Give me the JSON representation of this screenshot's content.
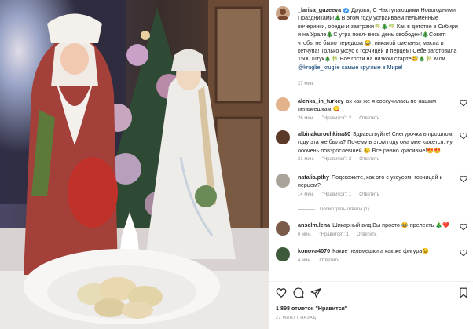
{
  "post": {
    "username": "_larisa_guzeeva",
    "caption": "Друзья, С Наступающими Новогодними Праздниками!🎄В этом году устраиваем пельменные вечеринки, обеды и завтраки🎋🎄🎋 Как в детстве в Сибири и на Урале🎄С утра поел- весь день свободен!🎄Совет: чтобы не было передоза 😂, никакой сметаны, масла и кетчупа! Только уксус с горчицей и перцем! Себе заготовила 1500 штук🎄🎋 Все гости на низком старте😅🎄🎋 Мои",
    "hashtag": "@kruglie_kruglie самые круглые в Мире!",
    "time": "27 мин."
  },
  "comments": [
    {
      "username": "alenka_in_turkey",
      "text": "ах как же я соскучилась по нашим пельмешкам 😋",
      "time": "26 мин.",
      "likes": "\"Нравится\": 2",
      "reply": "Ответить"
    },
    {
      "username": "albinakurochkina80",
      "text": "Здравствуйте! Снегурочка в прошлом году эта же была? Почему в этом году она мне кажется, ну ооочень повзрослевшей 😉 Все равно красивые!😍😍",
      "time": "21 мин.",
      "likes": "\"Нравится\": 2",
      "reply": "Ответить"
    },
    {
      "username": "natalia.pthy",
      "text": "Подскажите, как это с уксусом, горчицей и перцем?",
      "time": "14 мин.",
      "likes": "\"Нравится\": 1",
      "reply": "Ответить",
      "view_replies": "Посмотреть ответы (1)"
    },
    {
      "username": "anselm.lena",
      "text": "Шикарный вид.Вы просто 😂 прелесть 🎄❤️",
      "time": "6 мин.",
      "likes": "\"Нравится\": 1",
      "reply": "Ответить"
    },
    {
      "username": "konova4070",
      "text": "Какие пельмешки а как же фигура😉",
      "time": "4 мин.",
      "reply": "Ответить"
    }
  ],
  "footer": {
    "likes": "1 898 отметок \"Нравится\"",
    "time": "27 МИНУТ НАЗАД"
  }
}
